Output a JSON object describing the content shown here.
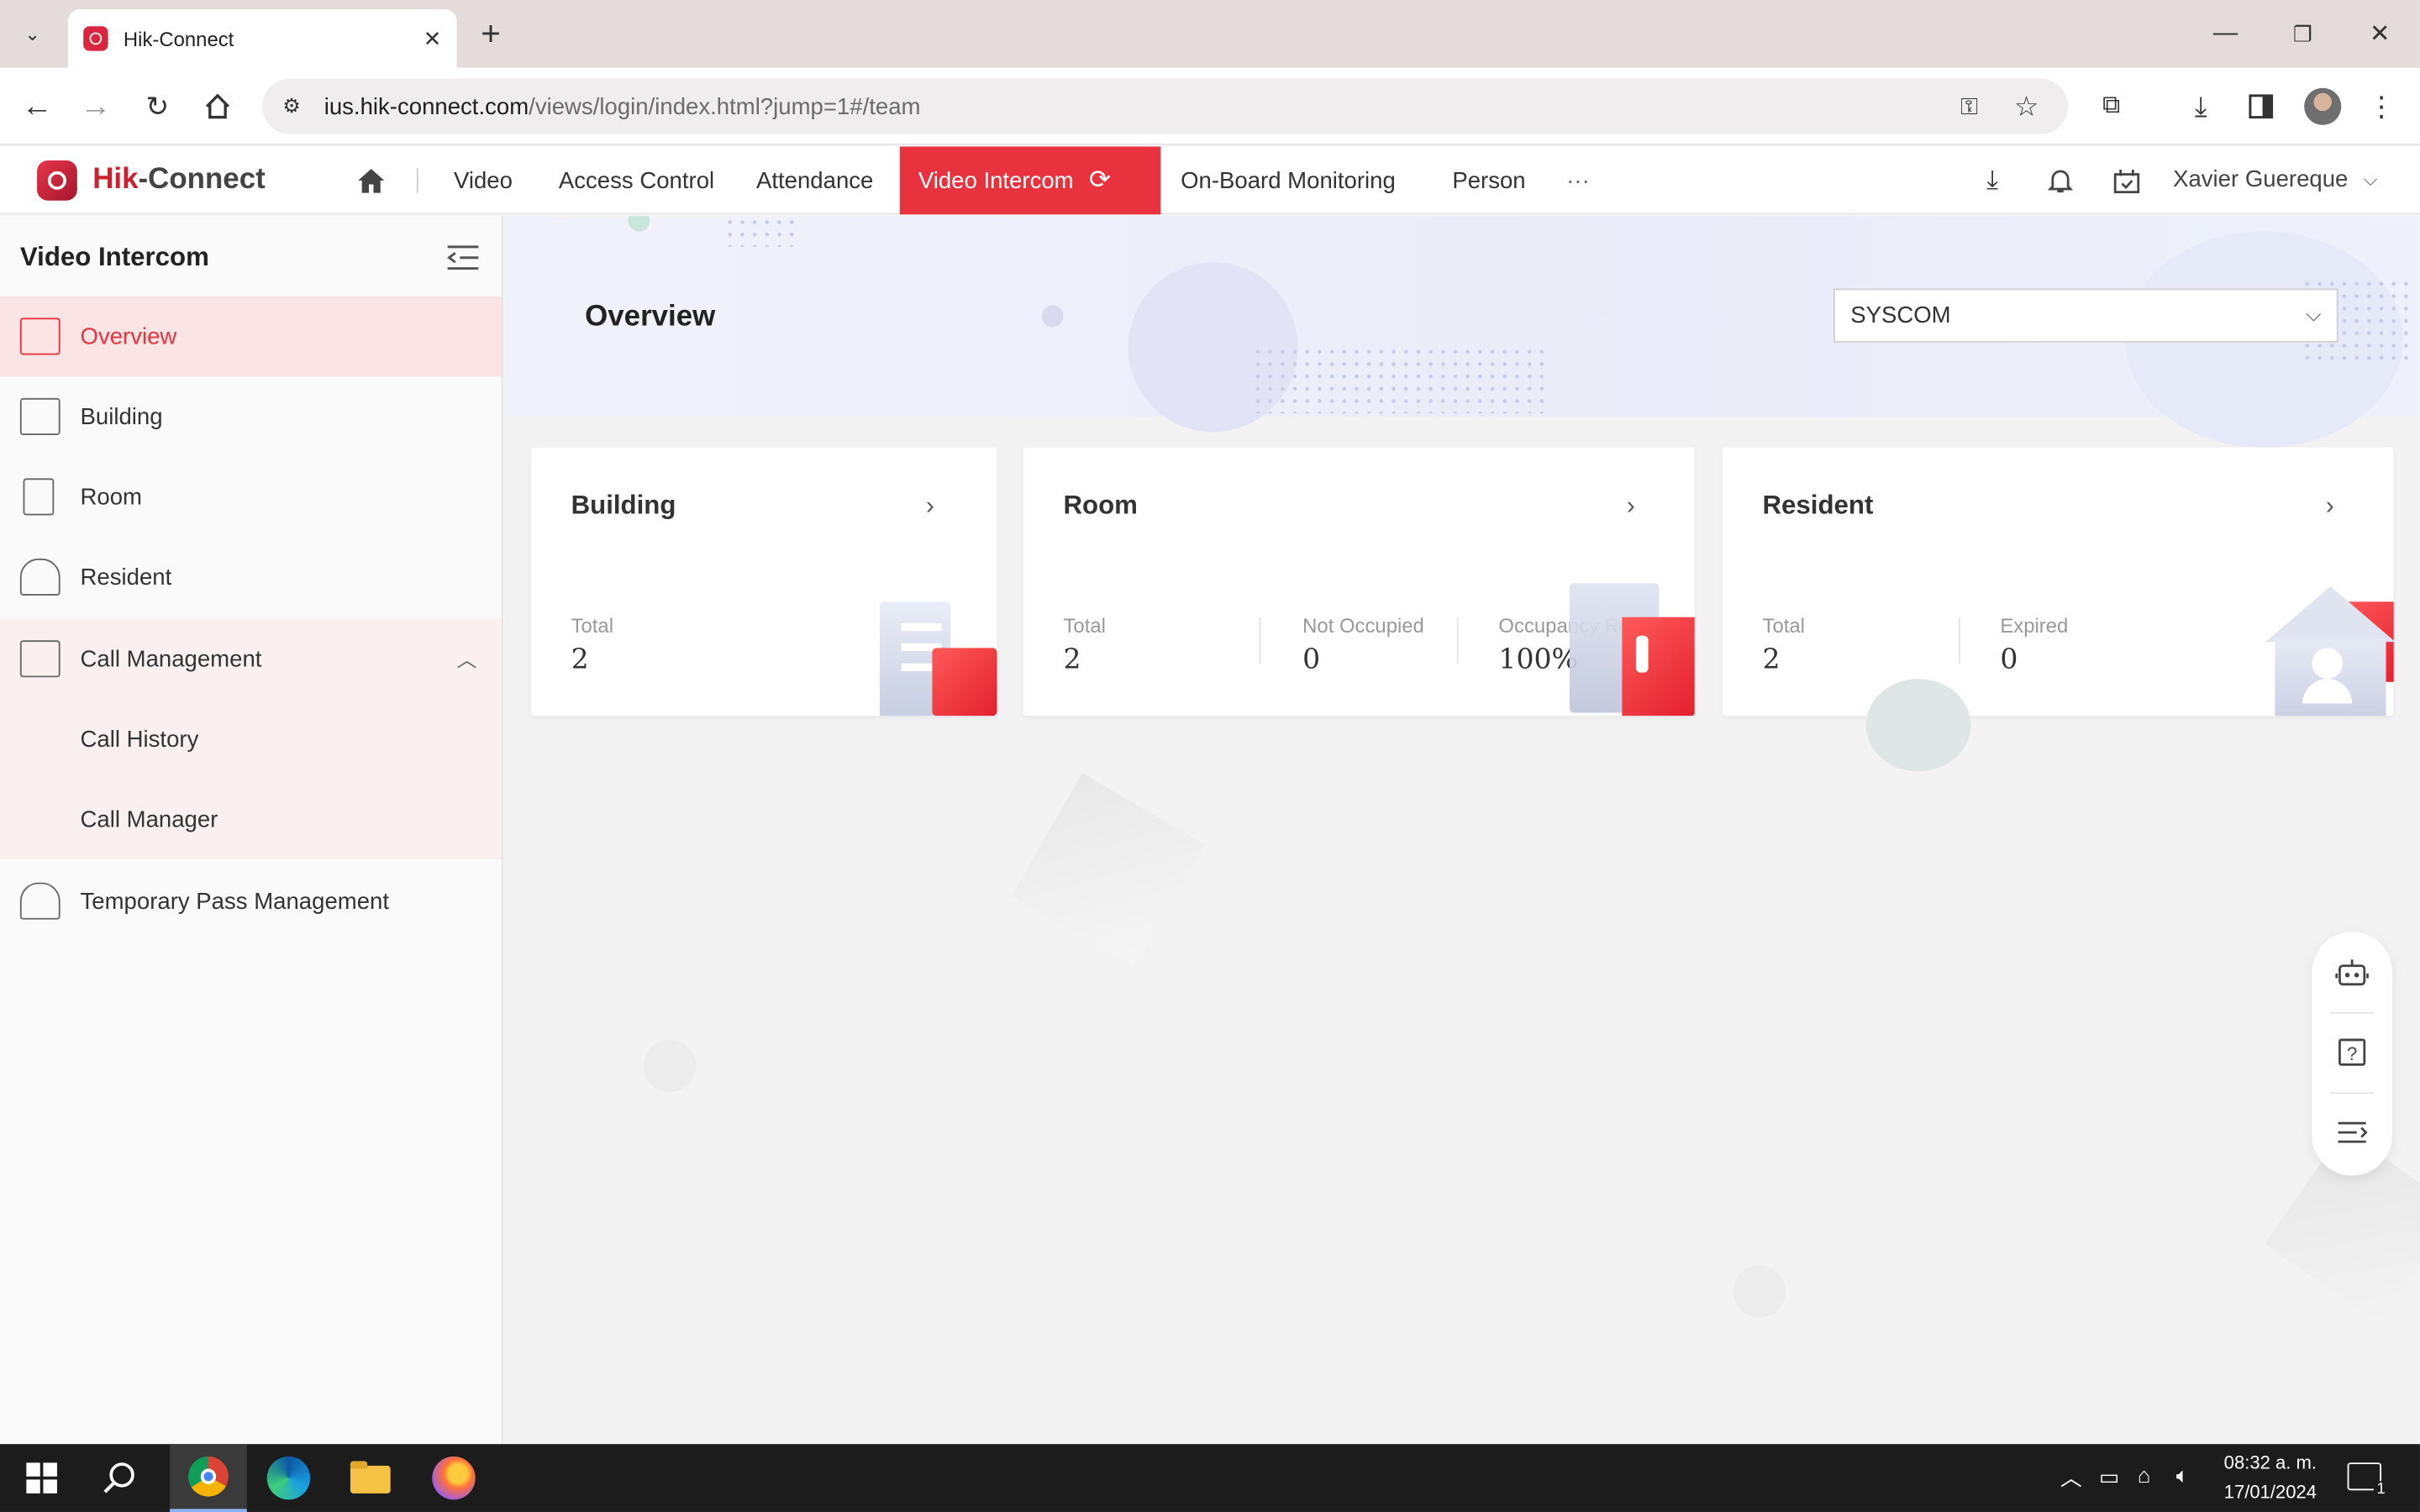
{
  "browser": {
    "tab_title": "Hik-Connect",
    "url_host": "ius.hik-connect.com",
    "url_path": "/views/login/index.html?jump=1#/team"
  },
  "app": {
    "logo_hik": "Hik",
    "logo_connect": "-Connect",
    "nav": [
      "Video",
      "Access Control",
      "Attendance",
      "Video Intercom",
      "On-Board Monitoring",
      "Person",
      "···"
    ],
    "user": "Xavier Guereque"
  },
  "sidebar": {
    "title": "Video Intercom",
    "items": [
      {
        "label": "Overview",
        "icon": "overview-icon",
        "active": true
      },
      {
        "label": "Building",
        "icon": "building-icon"
      },
      {
        "label": "Room",
        "icon": "room-icon"
      },
      {
        "label": "Resident",
        "icon": "resident-icon"
      },
      {
        "label": "Call Management",
        "icon": "call-management-icon",
        "expanded": true
      },
      {
        "label": "Call History"
      },
      {
        "label": "Call Manager"
      },
      {
        "label": "Temporary Pass Management",
        "icon": "temporary-pass-icon"
      }
    ]
  },
  "main": {
    "title": "Overview",
    "site_select": "SYSCOM",
    "cards": {
      "building": {
        "title": "Building",
        "total_label": "Total",
        "total": "2"
      },
      "room": {
        "title": "Room",
        "total_label": "Total",
        "total": "2",
        "not_occupied_label": "Not Occupied",
        "not_occupied": "0",
        "occupancy_label": "Occupancy Rate",
        "occupancy": "100%"
      },
      "resident": {
        "title": "Resident",
        "total_label": "Total",
        "total": "2",
        "expired_label": "Expired",
        "expired": "0"
      }
    }
  },
  "taskbar": {
    "time": "08:32 a. m.",
    "date": "17/01/2024",
    "notifications": "1"
  },
  "colors": {
    "accent": "#e8333f",
    "brand": "#c9212f"
  }
}
